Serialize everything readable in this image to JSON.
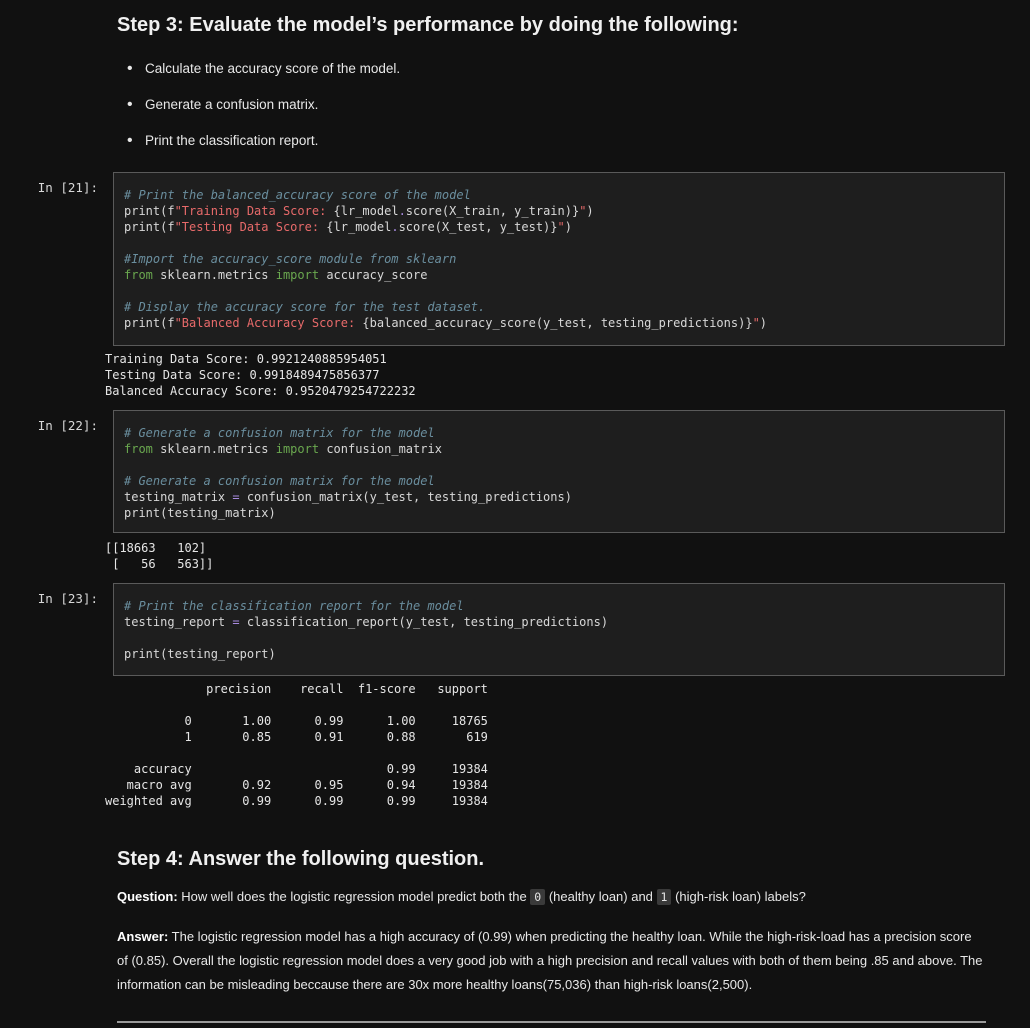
{
  "step3": {
    "heading": "Step 3: Evaluate the model’s performance by doing the following:",
    "bullets": [
      "Calculate the accuracy score of the model.",
      "Generate a confusion matrix.",
      "Print the classification report."
    ]
  },
  "cells": [
    {
      "prompt": "In [21]:",
      "lines": [
        "# Print the balanced_accuracy score of the model",
        "print(f\"Training Data Score: {lr_model.score(X_train, y_train)}\")",
        "print(f\"Testing Data Score: {lr_model.score(X_test, y_test)}\")",
        "",
        "#Import the accuracy_score module from sklearn",
        "from sklearn.metrics import accuracy_score",
        "",
        "# Display the accuracy score for the test dataset.",
        "print(f\"Balanced Accuracy Score: {balanced_accuracy_score(y_test, testing_predictions)}\")"
      ],
      "output": [
        "Training Data Score: 0.9921240885954051",
        "Testing Data Score: 0.9918489475856377",
        "Balanced Accuracy Score: 0.9520479254722232"
      ]
    },
    {
      "prompt": "In [22]:",
      "lines": [
        "# Generate a confusion matrix for the model",
        "from sklearn.metrics import confusion_matrix",
        "",
        "# Generate a confusion matrix for the model",
        "testing_matrix = confusion_matrix(y_test, testing_predictions)",
        "print(testing_matrix)"
      ],
      "output": [
        "[[18663   102]",
        " [   56   563]]"
      ]
    },
    {
      "prompt": "In [23]:",
      "lines": [
        "# Print the classification report for the model",
        "testing_report = classification_report(y_test, testing_predictions)",
        "",
        "print(testing_report)"
      ],
      "output": [
        "              precision    recall  f1-score   support",
        "",
        "           0       1.00      0.99      1.00     18765",
        "           1       0.85      0.91      0.88       619",
        "",
        "    accuracy                           0.99     19384",
        "   macro avg       0.92      0.95      0.94     19384",
        "weighted avg       0.99      0.99      0.99     19384"
      ]
    }
  ],
  "step4": {
    "heading": "Step 4: Answer the following question.",
    "question_label": "Question:",
    "question_pre": " How well does the logistic regression model predict both the ",
    "code0": "0",
    "question_mid": " (healthy loan) and ",
    "code1": "1",
    "question_post": " (high-risk loan) labels?",
    "answer_label": "Answer:",
    "answer_text": " The logistic regression model has a high accuracy of (0.99) when predicting the healthy loan. While the high-risk-load has a precision score of (0.85). Overall the logistic regression model does a very good job with a high precision and recall values with both of them being .85 and above. The information can be misleading beccause there are 30x more healthy loans(75,036) than high-risk loans(2,500)."
  }
}
